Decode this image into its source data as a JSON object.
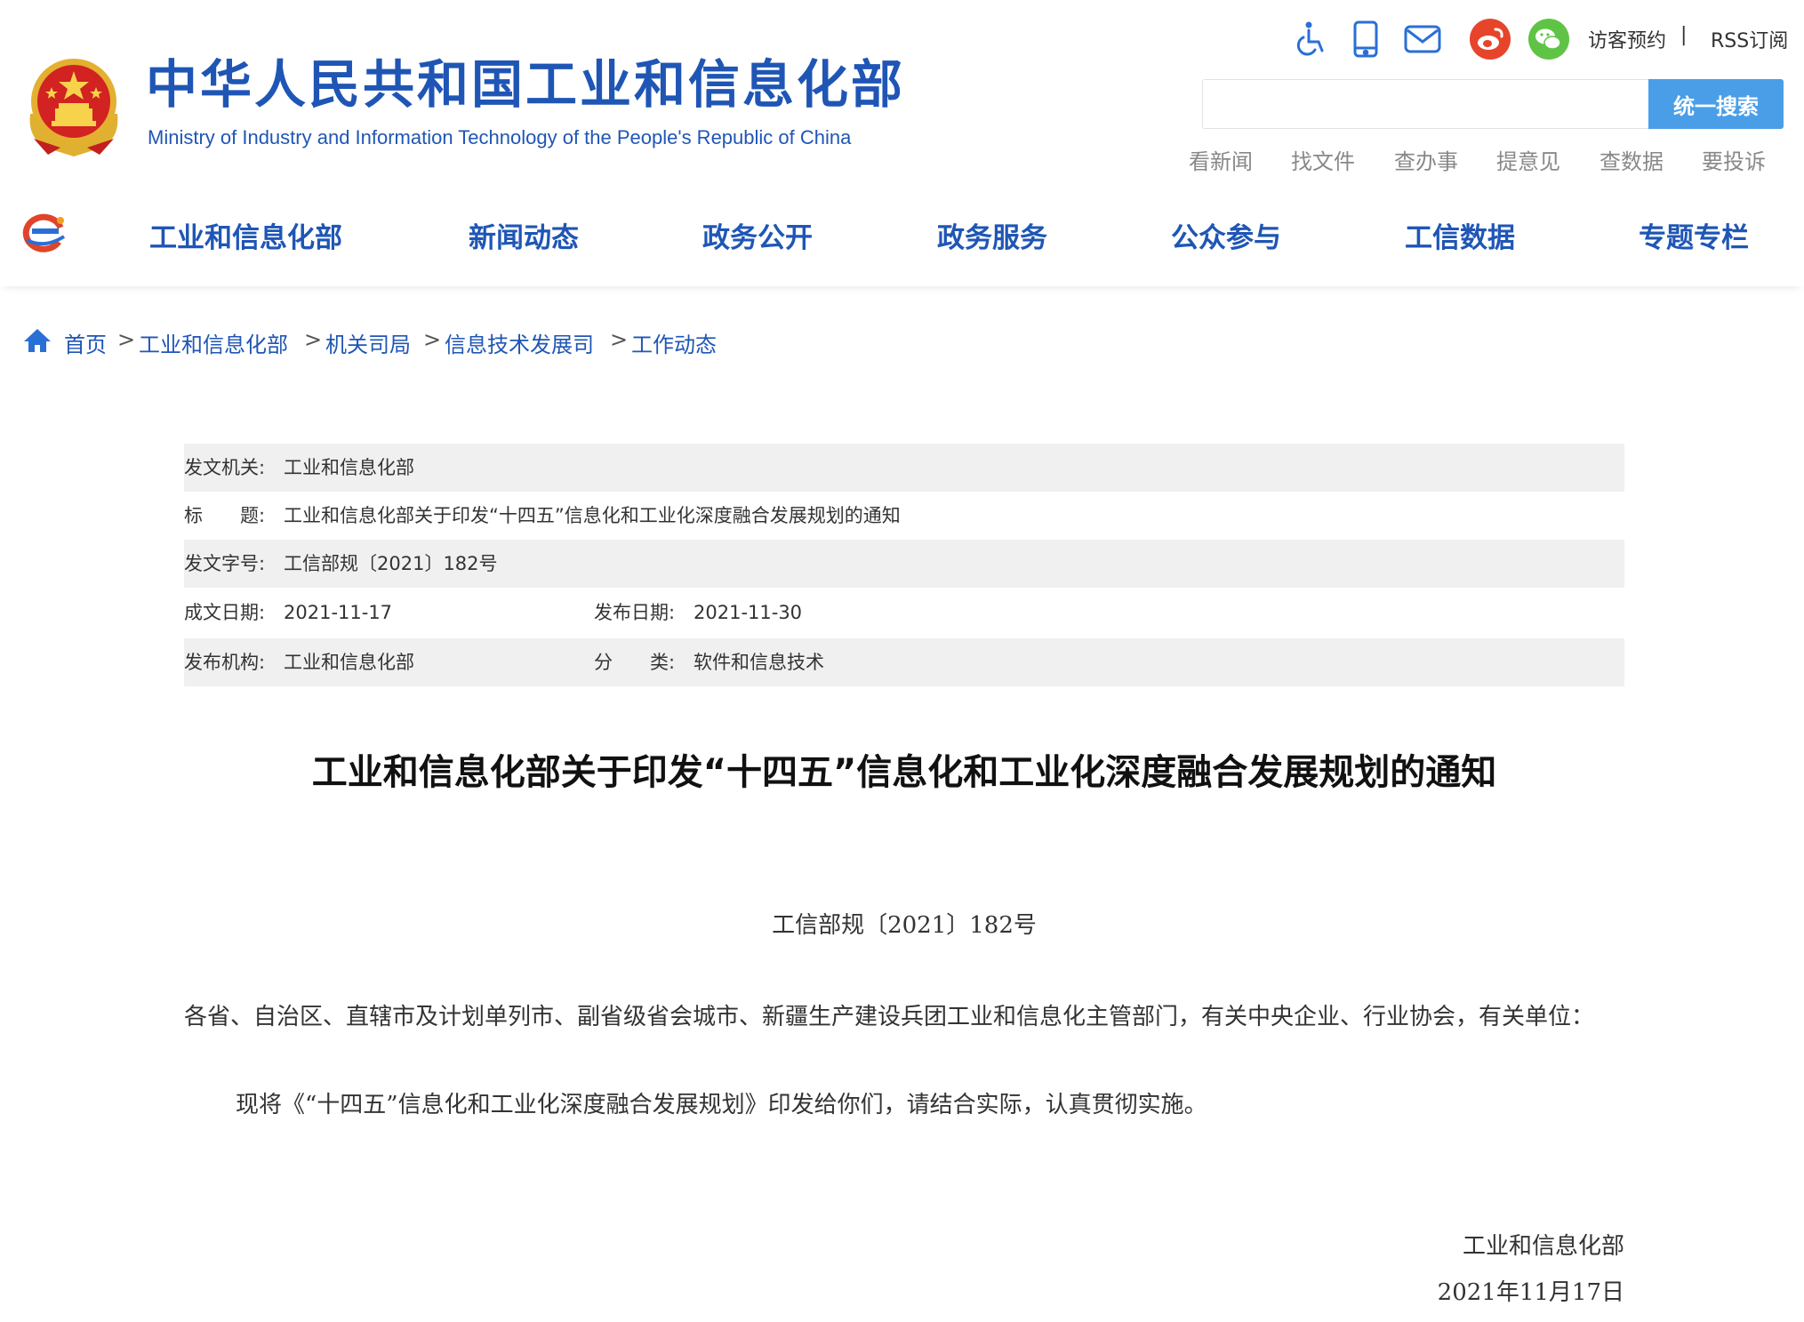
{
  "header": {
    "site_name_cn": "中华人民共和国工业和信息化部",
    "site_name_en": "Ministry of Industry and Information Technology of the People's Republic of China",
    "top_links": {
      "visit": "访客预约",
      "separator": "|",
      "rss": "RSS订阅"
    },
    "top_icons": [
      "accessibility-icon",
      "mobile-icon",
      "mail-icon",
      "weibo-icon",
      "wechat-icon"
    ],
    "search": {
      "placeholder": "",
      "button": "统一搜索"
    },
    "quick_links": [
      "看新闻",
      "找文件",
      "查办事",
      "提意见",
      "查数据",
      "要投诉"
    ]
  },
  "nav": {
    "items": [
      "工业和信息化部",
      "新闻动态",
      "政务公开",
      "政务服务",
      "公众参与",
      "工信数据",
      "专题专栏"
    ]
  },
  "breadcrumb": {
    "items": [
      "首页",
      "工业和信息化部",
      "机关司局",
      "信息技术发展司",
      "工作动态"
    ],
    "separator": ">"
  },
  "meta": {
    "issuer_label": "发文机关:",
    "issuer": "工业和信息化部",
    "title_label": "标　　题:",
    "title": "工业和信息化部关于印发“十四五”信息化和工业化深度融合发展规划的通知",
    "doc_no_label": "发文字号:",
    "doc_no": "工信部规〔2021〕182号",
    "written_date_label": "成文日期:",
    "written_date": "2021-11-17",
    "publish_date_label": "发布日期:",
    "publish_date": "2021-11-30",
    "agency_label": "发布机构:",
    "agency": "工业和信息化部",
    "category_label": "分　　类:",
    "category": "软件和信息技术"
  },
  "document": {
    "title": "工业和信息化部关于印发“十四五”信息化和工业化深度融合发展规划的通知",
    "number": "工信部规〔2021〕182号",
    "recipients": "各省、自治区、直辖市及计划单列市、副省级省会城市、新疆生产建设兵团工业和信息化主管部门，有关中央企业、行业协会，有关单位：",
    "body": "现将《“十四五”信息化和工业化深度融合发展规划》印发给你们，请结合实际，认真贯彻实施。",
    "signature_org": "工业和信息化部",
    "signature_date": "2021年11月17日"
  },
  "colors": {
    "brand_blue": "#1f56b5",
    "search_button": "#4a9ee8",
    "row_shade": "#f0f0f0",
    "weibo_red": "#e6452b",
    "wechat_green": "#5fc445"
  }
}
